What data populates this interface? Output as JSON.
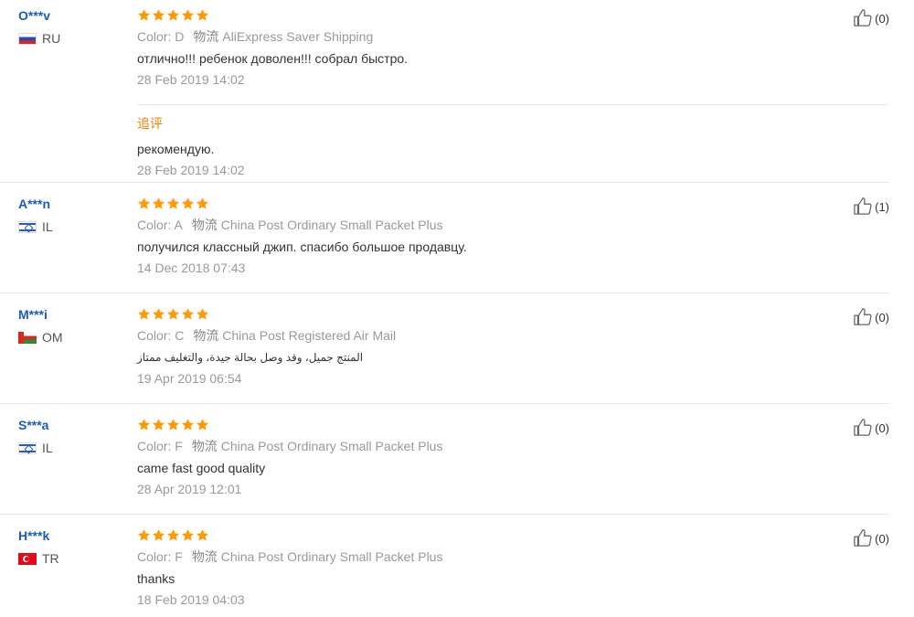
{
  "reviews": [
    {
      "user": "O***v",
      "country": "RU",
      "flag": "ru",
      "color_label": "Color:",
      "color_value": "D",
      "ship_label": "物流",
      "ship_value": "AliExpress Saver Shipping",
      "text": "отлично!!! ребенок доволен!!! собрал быстро.",
      "date": "28 Feb 2019 14:02",
      "likes": "(0)",
      "followup": {
        "label": "追评",
        "text": "рекомендую.",
        "date": "28 Feb 2019 14:02"
      }
    },
    {
      "user": "A***n",
      "country": "IL",
      "flag": "il",
      "color_label": "Color:",
      "color_value": "A",
      "ship_label": "物流",
      "ship_value": "China Post Ordinary Small Packet Plus",
      "text": "получился классный джип. спасибо большое продавцу.",
      "date": "14 Dec 2018 07:43",
      "likes": "(1)"
    },
    {
      "user": "M***i",
      "country": "OM",
      "flag": "om",
      "color_label": "Color:",
      "color_value": "C",
      "ship_label": "物流",
      "ship_value": "China Post Registered Air Mail",
      "text": "المنتج جميل، وقد وصل بحالة جيدة، والتغليف ممتاز",
      "date": "19 Apr 2019 06:54",
      "likes": "(0)"
    },
    {
      "user": "S***a",
      "country": "IL",
      "flag": "il",
      "color_label": "Color:",
      "color_value": "F",
      "ship_label": "物流",
      "ship_value": "China Post Ordinary Small Packet Plus",
      "text": "came fast good quality",
      "date": "28 Apr 2019 12:01",
      "likes": "(0)"
    },
    {
      "user": "H***k",
      "country": "TR",
      "flag": "tr",
      "color_label": "Color:",
      "color_value": "F",
      "ship_label": "物流",
      "ship_value": "China Post Ordinary Small Packet Plus",
      "text": "thanks",
      "date": "18 Feb 2019 04:03",
      "likes": "(0)"
    }
  ],
  "rating_stars": 5,
  "colors": {
    "star": "#ff9a00",
    "username": "#1b5bbd",
    "followup_label": "#f08200",
    "muted": "#999999"
  },
  "icons": {
    "rating": "star-icon",
    "like": "thumbs-up-icon"
  }
}
